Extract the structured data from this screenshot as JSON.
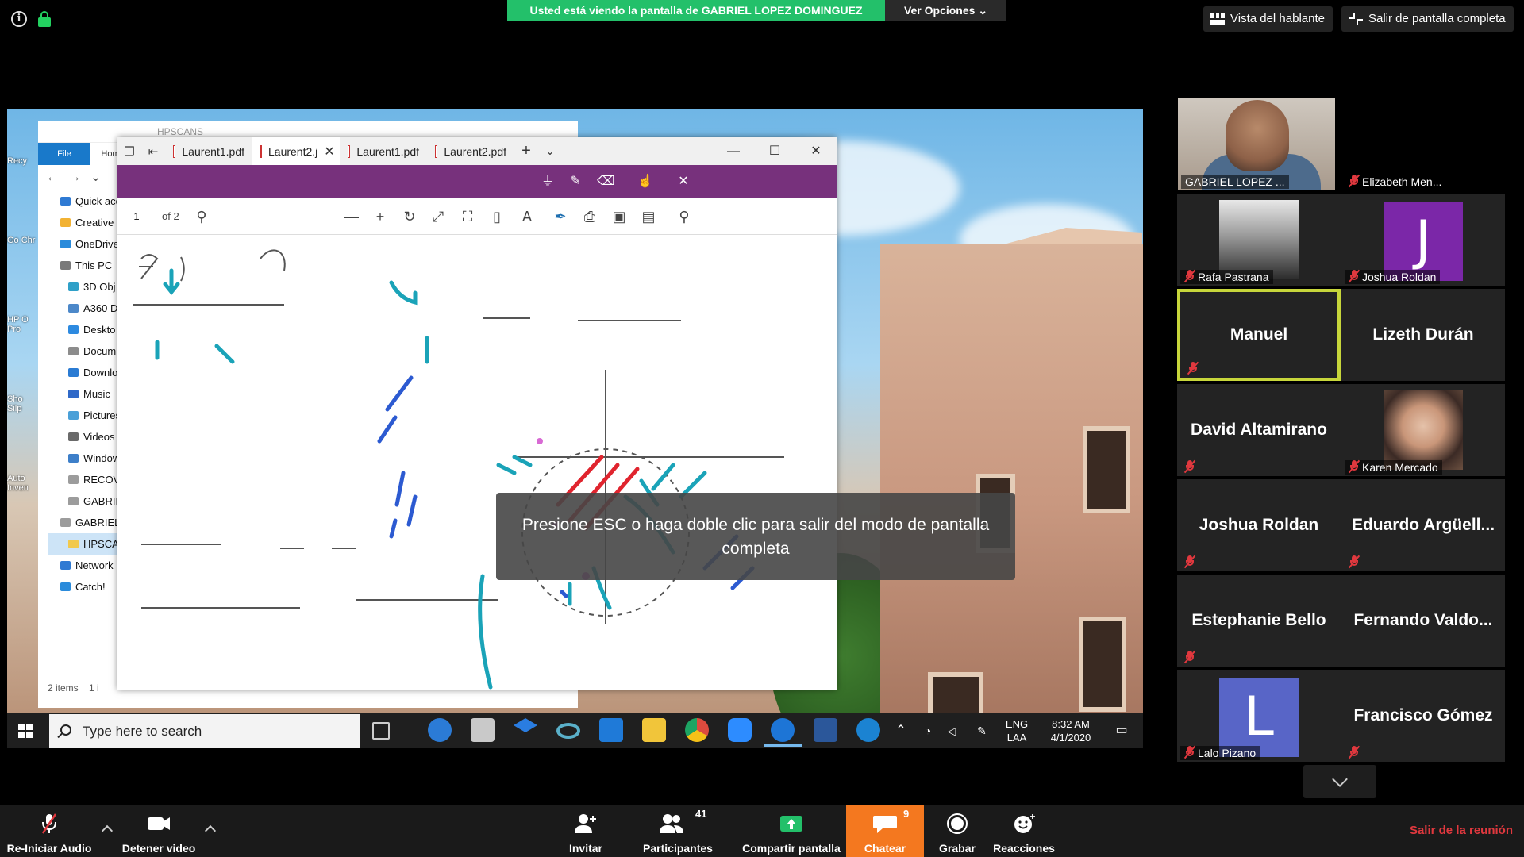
{
  "top_bar": {
    "viewing_text": "Usted está viendo la pantalla de GABRIEL LOPEZ DOMINGUEZ",
    "options_label": "Ver Opciones",
    "speaker_view_label": "Vista del hablante",
    "exit_fullscreen_label": "Salir de pantalla completa"
  },
  "explorer": {
    "title": "HPSCANS",
    "file_tab": "File",
    "home_tab": "Hom",
    "nav_items": [
      "Quick acc",
      "Creative C",
      "OneDrive",
      "This PC",
      "3D Obj",
      "A360 D",
      "Deskto",
      "Docum",
      "Downlo",
      "Music",
      "Pictures",
      "Videos",
      "Window",
      "RECOV",
      "GABRIE",
      "GABRIEL",
      "HPSCA",
      "Network",
      "Catch!"
    ],
    "footer": "2 items",
    "footer_extra": "1 i"
  },
  "desktop_icons": [
    "Recy",
    "Go Chr",
    "HP O Pro",
    "Sho Silp",
    "Auto Inven"
  ],
  "pdf_viewer": {
    "tabs": [
      {
        "label": "Laurent1.pdf",
        "active": false
      },
      {
        "label": "Laurent2.j",
        "active": true
      },
      {
        "label": "Laurent1.pdf",
        "active": false
      },
      {
        "label": "Laurent2.pdf",
        "active": false
      }
    ],
    "page_number": "1",
    "page_total": "of 2"
  },
  "fullscreen_toast": "Presione ESC o haga doble clic para salir del modo de pantalla completa",
  "taskbar": {
    "search_placeholder": "Type here to search",
    "language": "ENG",
    "layout": "LAA",
    "time": "8:32 AM",
    "date": "4/1/2020"
  },
  "participants": [
    {
      "name": "GABRIEL LOPEZ ...",
      "type": "video",
      "muted": false
    },
    {
      "name": "Elizabeth Men...",
      "type": "mini",
      "muted": true
    },
    {
      "name": "Rafa Pastrana",
      "type": "photo",
      "muted": true
    },
    {
      "name": "Joshua Roldan",
      "type": "avatar",
      "letter": "J",
      "color": "#7b27a8",
      "muted": true
    },
    {
      "name": "Manuel",
      "type": "name",
      "muted": true,
      "speaking": true
    },
    {
      "name": "Lizeth Durán",
      "type": "name",
      "muted": false
    },
    {
      "name": "David Altamirano",
      "type": "name",
      "muted": true
    },
    {
      "name": "Karen Mercado",
      "type": "photo",
      "muted": true
    },
    {
      "name": "Joshua Roldan",
      "type": "name",
      "muted": true
    },
    {
      "name": "Eduardo  Argüell...",
      "type": "name",
      "muted": true
    },
    {
      "name": "Estephanie Bello",
      "type": "name",
      "muted": true
    },
    {
      "name": "Fernando  Valdo...",
      "type": "name",
      "muted": false
    },
    {
      "name": "Lalo Pizano",
      "type": "avatar",
      "letter": "L",
      "color": "#5865c7",
      "muted": true
    },
    {
      "name": "Francisco Gómez",
      "type": "name",
      "muted": true
    }
  ],
  "toolbar": {
    "audio_label": "Re-Iniciar Audio",
    "video_label": "Detener video",
    "invite_label": "Invitar",
    "participants_label": "Participantes",
    "participants_count": "41",
    "share_label": "Compartir pantalla",
    "chat_label": "Chatear",
    "chat_count": "9",
    "record_label": "Grabar",
    "reactions_label": "Reacciones",
    "leave_label": "Salir de la reunión"
  },
  "colors": {
    "banner_green": "#23c06a",
    "speaking_border": "#c7d63b",
    "chat_orange": "#f4781f",
    "muted_red": "#e0383e",
    "pdf_purple": "#77317c"
  }
}
